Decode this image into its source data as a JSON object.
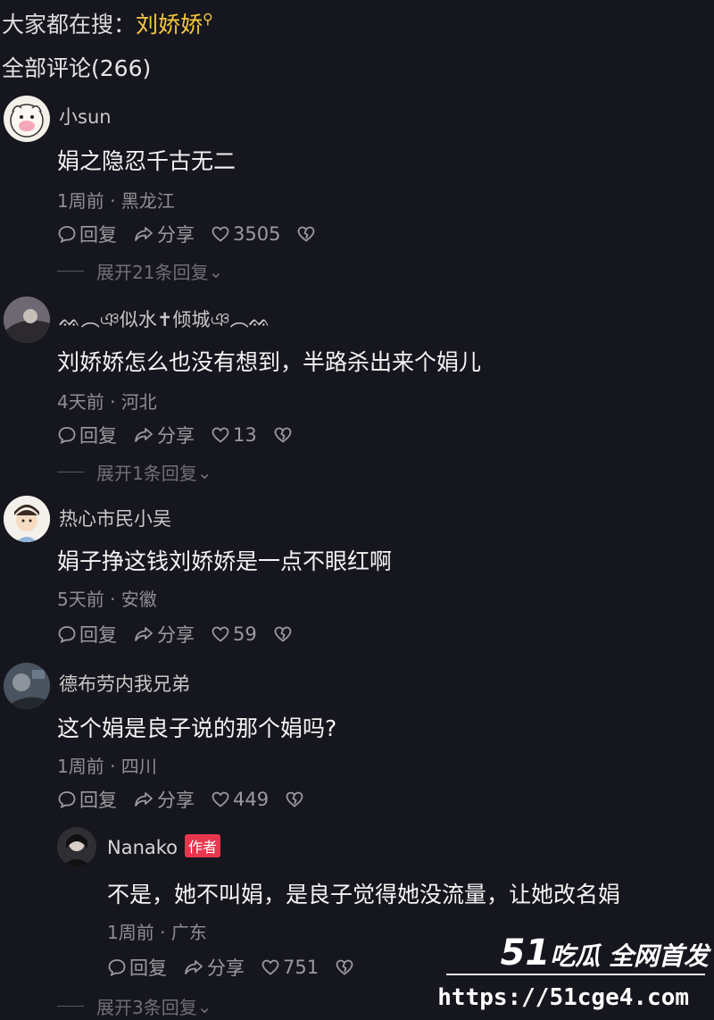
{
  "search_hint": {
    "prefix": "大家都在搜：",
    "keyword": "刘娇娇"
  },
  "comments_header": "全部评论(266)",
  "actions": {
    "reply": "回复",
    "share": "分享"
  },
  "comments": [
    {
      "username": "小sun",
      "text": "娟之隐忍千古无二",
      "meta": "1周前 · 黑龙江",
      "likes": "3505",
      "expand": "展开21条回复"
    },
    {
      "username": "ᨐ︵ঞ似水✝倾城ঞ︵ᨐ",
      "text": "刘娇娇怎么也没有想到，半路杀出来个娟儿",
      "meta": "4天前 · 河北",
      "likes": "13",
      "expand": "展开1条回复"
    },
    {
      "username": "热心市民小吴",
      "text": "娟子挣这钱刘娇娇是一点不眼红啊",
      "meta": "5天前 · 安徽",
      "likes": "59"
    },
    {
      "username": "德布劳内我兄弟",
      "text": "这个娟是良子说的那个娟吗?",
      "meta": "1周前 · 四川",
      "likes": "449"
    }
  ],
  "reply": {
    "username": "Nanako",
    "author_tag": "作者",
    "text": "不是，她不叫娟，是良子觉得她没流量，让她改名娟",
    "meta": "1周前 · 广东",
    "likes": "751",
    "expand": "展开3条回复"
  },
  "watermark": {
    "brand_num": "51",
    "brand_text": "吃瓜 全网首发",
    "url": "https://51cge4.com"
  },
  "colors": {
    "background": "#16161e",
    "keyword": "#f5c73e",
    "author_tag": "#e9364f"
  }
}
